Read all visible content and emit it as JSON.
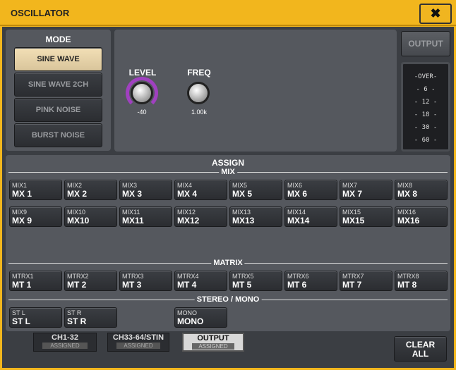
{
  "window": {
    "title": "OSCILLATOR",
    "close_icon": "close-icon"
  },
  "mode": {
    "header": "MODE",
    "items": [
      {
        "label": "SINE WAVE",
        "active": true
      },
      {
        "label": "SINE WAVE 2CH",
        "active": false
      },
      {
        "label": "PINK NOISE",
        "active": false
      },
      {
        "label": "BURST NOISE",
        "active": false
      }
    ]
  },
  "knobs": {
    "level": {
      "label": "LEVEL",
      "value": "-40"
    },
    "freq": {
      "label": "FREQ",
      "value": "1.00k"
    }
  },
  "output": {
    "label": "OUTPUT",
    "meter_scale": [
      "-OVER-",
      "- 6 -",
      "- 12 -",
      "- 18 -",
      "- 30 -",
      "- 60 -"
    ]
  },
  "assign": {
    "header": "ASSIGN",
    "mix_label": "MIX",
    "matrix_label": "MATRIX",
    "stereo_label": "STEREO / MONO",
    "mix": [
      [
        "MIX1",
        "MX 1"
      ],
      [
        "MIX2",
        "MX 2"
      ],
      [
        "MIX3",
        "MX 3"
      ],
      [
        "MIX4",
        "MX 4"
      ],
      [
        "MIX5",
        "MX 5"
      ],
      [
        "MIX6",
        "MX 6"
      ],
      [
        "MIX7",
        "MX 7"
      ],
      [
        "MIX8",
        "MX 8"
      ],
      [
        "MIX9",
        "MX 9"
      ],
      [
        "MIX10",
        "MX10"
      ],
      [
        "MIX11",
        "MX11"
      ],
      [
        "MIX12",
        "MX12"
      ],
      [
        "MIX13",
        "MX13"
      ],
      [
        "MIX14",
        "MX14"
      ],
      [
        "MIX15",
        "MX15"
      ],
      [
        "MIX16",
        "MX16"
      ]
    ],
    "matrix": [
      [
        "MTRX1",
        "MT 1"
      ],
      [
        "MTRX2",
        "MT 2"
      ],
      [
        "MTRX3",
        "MT 3"
      ],
      [
        "MTRX4",
        "MT 4"
      ],
      [
        "MTRX5",
        "MT 5"
      ],
      [
        "MTRX6",
        "MT 6"
      ],
      [
        "MTRX7",
        "MT 7"
      ],
      [
        "MTRX8",
        "MT 8"
      ]
    ],
    "stereo": [
      [
        "ST L",
        "ST L"
      ],
      [
        "ST R",
        "ST R"
      ],
      [
        "MONO",
        "MONO"
      ]
    ]
  },
  "tabs": [
    {
      "label": "CH1-32",
      "sub": "ASSIGNED",
      "active": false
    },
    {
      "label": "CH33-64/STIN",
      "sub": "ASSIGNED",
      "active": false
    },
    {
      "label": "OUTPUT",
      "sub": "ASSIGNED",
      "active": true
    }
  ],
  "clear_all": "CLEAR ALL",
  "colors": {
    "title_bar": "#f2b61d",
    "level_ring": "#a040c0",
    "active_mode": "#f2dfb6"
  }
}
